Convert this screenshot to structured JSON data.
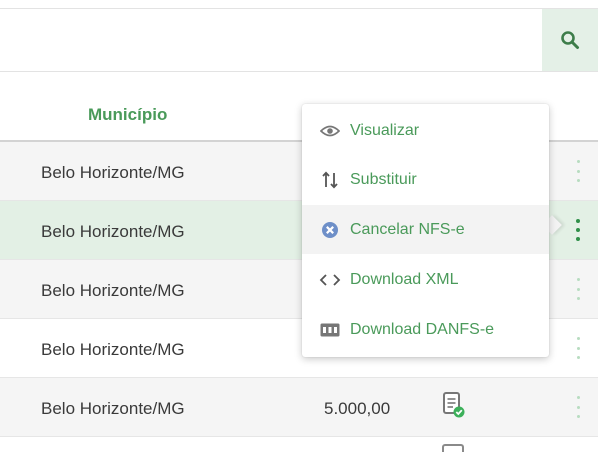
{
  "search": {
    "value": "",
    "placeholder": ""
  },
  "table": {
    "header": {
      "municipio": "Município"
    },
    "rows": [
      {
        "city": "Belo Horizonte/MG",
        "value": ""
      },
      {
        "city": "Belo Horizonte/MG",
        "value": ""
      },
      {
        "city": "Belo Horizonte/MG",
        "value": ""
      },
      {
        "city": "Belo Horizonte/MG",
        "value": ""
      },
      {
        "city": "Belo Horizonte/MG",
        "value": "5.000,00"
      }
    ]
  },
  "menu": {
    "items": [
      {
        "label": "Visualizar",
        "icon": "eye-icon"
      },
      {
        "label": "Substituir",
        "icon": "swap-arrows-icon"
      },
      {
        "label": "Cancelar NFS-e",
        "icon": "cancel-circle-icon"
      },
      {
        "label": "Download XML",
        "icon": "code-icon"
      },
      {
        "label": "Download DANFS-e",
        "icon": "pdf-icon"
      }
    ]
  },
  "colors": {
    "accent_green": "#4a9a5a",
    "active_row": "#e3f0e5",
    "search_button_bg": "#e4f0e7",
    "cancel_icon": "#6e8fc8"
  }
}
